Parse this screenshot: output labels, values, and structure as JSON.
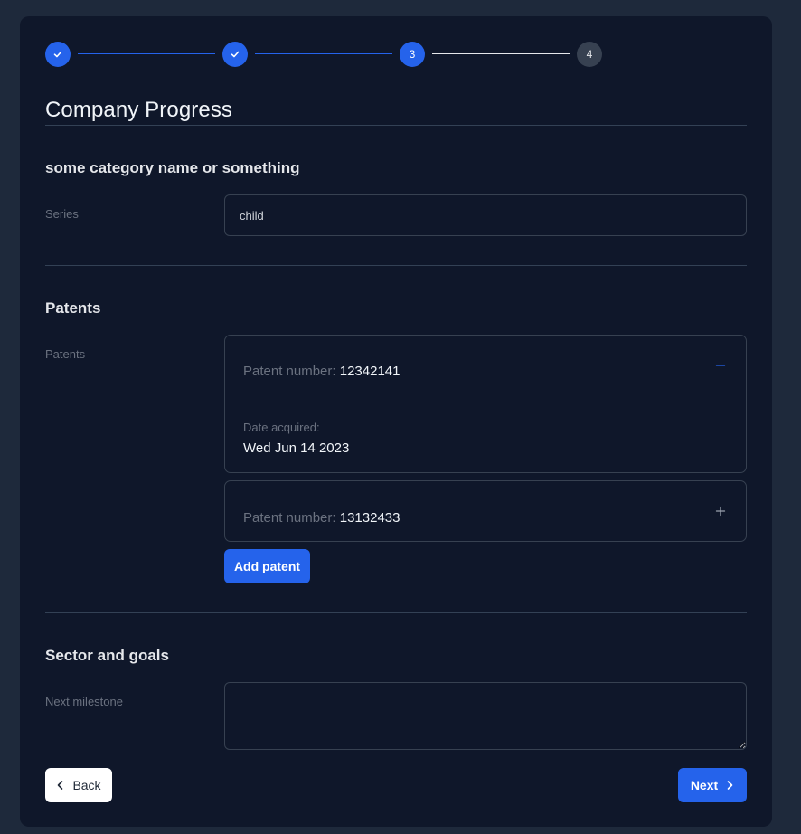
{
  "colors": {
    "page_bg": "#1e293b",
    "card_bg": "#0f172a",
    "accent": "#2563eb",
    "border": "#374151",
    "muted_text": "#6b7280"
  },
  "stepper": {
    "steps": [
      {
        "label": "",
        "state": "done",
        "icon": "check-icon"
      },
      {
        "label": "",
        "state": "done",
        "icon": "check-icon"
      },
      {
        "label": "3",
        "state": "current"
      },
      {
        "label": "4",
        "state": "upcoming"
      }
    ]
  },
  "page": {
    "title": "Company Progress"
  },
  "category_section": {
    "title": "some category name or something",
    "series_label": "Series",
    "series_value": "child"
  },
  "patents_section": {
    "title": "Patents",
    "field_label": "Patents",
    "patents": [
      {
        "number_label": "Patent number:",
        "number": "12342141",
        "expanded": true,
        "toggle_icon": "minus-icon",
        "date_label": "Date acquired:",
        "date": "Wed Jun 14 2023"
      },
      {
        "number_label": "Patent number:",
        "number": "13132433",
        "expanded": false,
        "toggle_icon": "plus-icon"
      }
    ],
    "add_button_label": "Add patent"
  },
  "sector_section": {
    "title": "Sector and goals",
    "milestone_label": "Next milestone",
    "milestone_value": ""
  },
  "footer": {
    "back_label": "Back",
    "next_label": "Next"
  }
}
